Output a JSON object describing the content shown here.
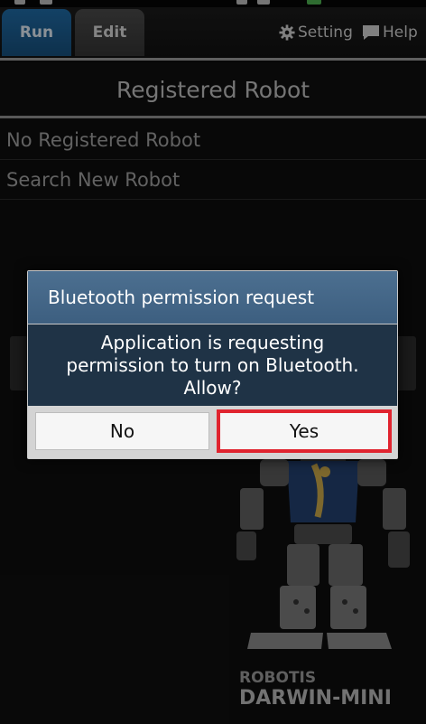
{
  "top_bar": {
    "tabs": [
      {
        "label": "Run",
        "active": true
      },
      {
        "label": "Edit",
        "active": false
      }
    ],
    "setting_label": "Setting",
    "help_label": "Help"
  },
  "section": {
    "title": "Registered Robot",
    "items": [
      {
        "label": "No Registered Robot"
      },
      {
        "label": "Search New Robot"
      }
    ]
  },
  "brand": {
    "top": "ROBOTIS",
    "bottom": "DARWIN-MINI"
  },
  "dialog": {
    "title": "Bluetooth permission request",
    "message_lines": [
      "Application is requesting",
      "permission to turn on Bluetooth.",
      "Allow?"
    ],
    "no_label": "No",
    "yes_label": "Yes"
  },
  "colors": {
    "accent_blue": "#1f6aa4",
    "dialog_title_bg": "#4c6f90",
    "dialog_body_bg": "#1f3346",
    "highlight_red": "#e0242f"
  }
}
